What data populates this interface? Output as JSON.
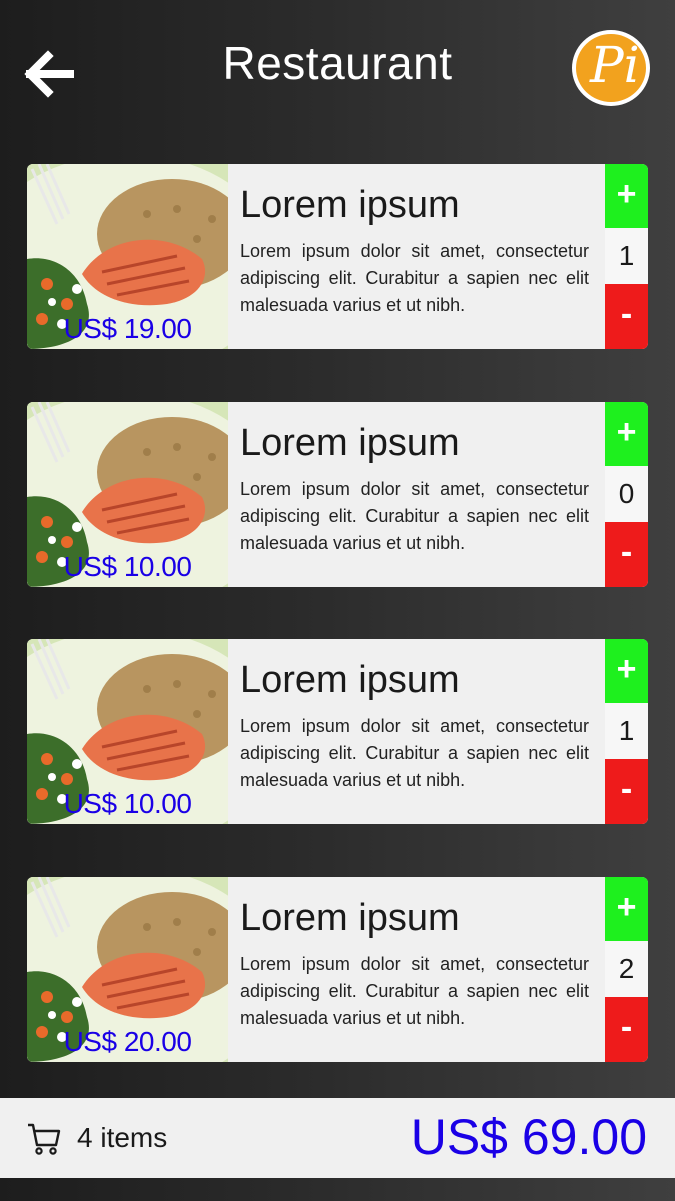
{
  "header": {
    "title": "Restaurant",
    "back_icon": "arrow-left-icon",
    "logo_text": "Pi"
  },
  "items": [
    {
      "title": "Lorem ipsum",
      "description": "Lorem ipsum dolor sit amet, consectetur adipiscing elit. Curabitur a sapien nec elit malesuada varius et ut nibh.",
      "price": "US$ 19.00",
      "quantity": "1",
      "plus_label": "+",
      "minus_label": "-"
    },
    {
      "title": "Lorem ipsum",
      "description": "Lorem ipsum dolor sit amet, consectetur adipiscing elit. Curabitur a sapien nec elit malesuada varius et ut nibh.",
      "price": "US$ 10.00",
      "quantity": "0",
      "plus_label": "+",
      "minus_label": "-"
    },
    {
      "title": "Lorem ipsum",
      "description": "Lorem ipsum dolor sit amet, consectetur adipiscing elit. Curabitur a sapien nec elit malesuada varius et ut nibh.",
      "price": "US$ 10.00",
      "quantity": "1",
      "plus_label": "+",
      "minus_label": "-"
    },
    {
      "title": "Lorem ipsum",
      "description": "Lorem ipsum dolor sit amet, consectetur adipiscing elit. Curabitur a sapien nec elit malesuada varius et ut nibh.",
      "price": "US$ 20.00",
      "quantity": "2",
      "plus_label": "+",
      "minus_label": "-"
    }
  ],
  "footer": {
    "cart_icon": "shopping-cart-icon",
    "items_count": "4 items",
    "total": "US$ 69.00"
  },
  "colors": {
    "accent_price": "#1a00e6",
    "plus": "#1ef01e",
    "minus": "#ee1b1b",
    "logo": "#f2a21e"
  }
}
